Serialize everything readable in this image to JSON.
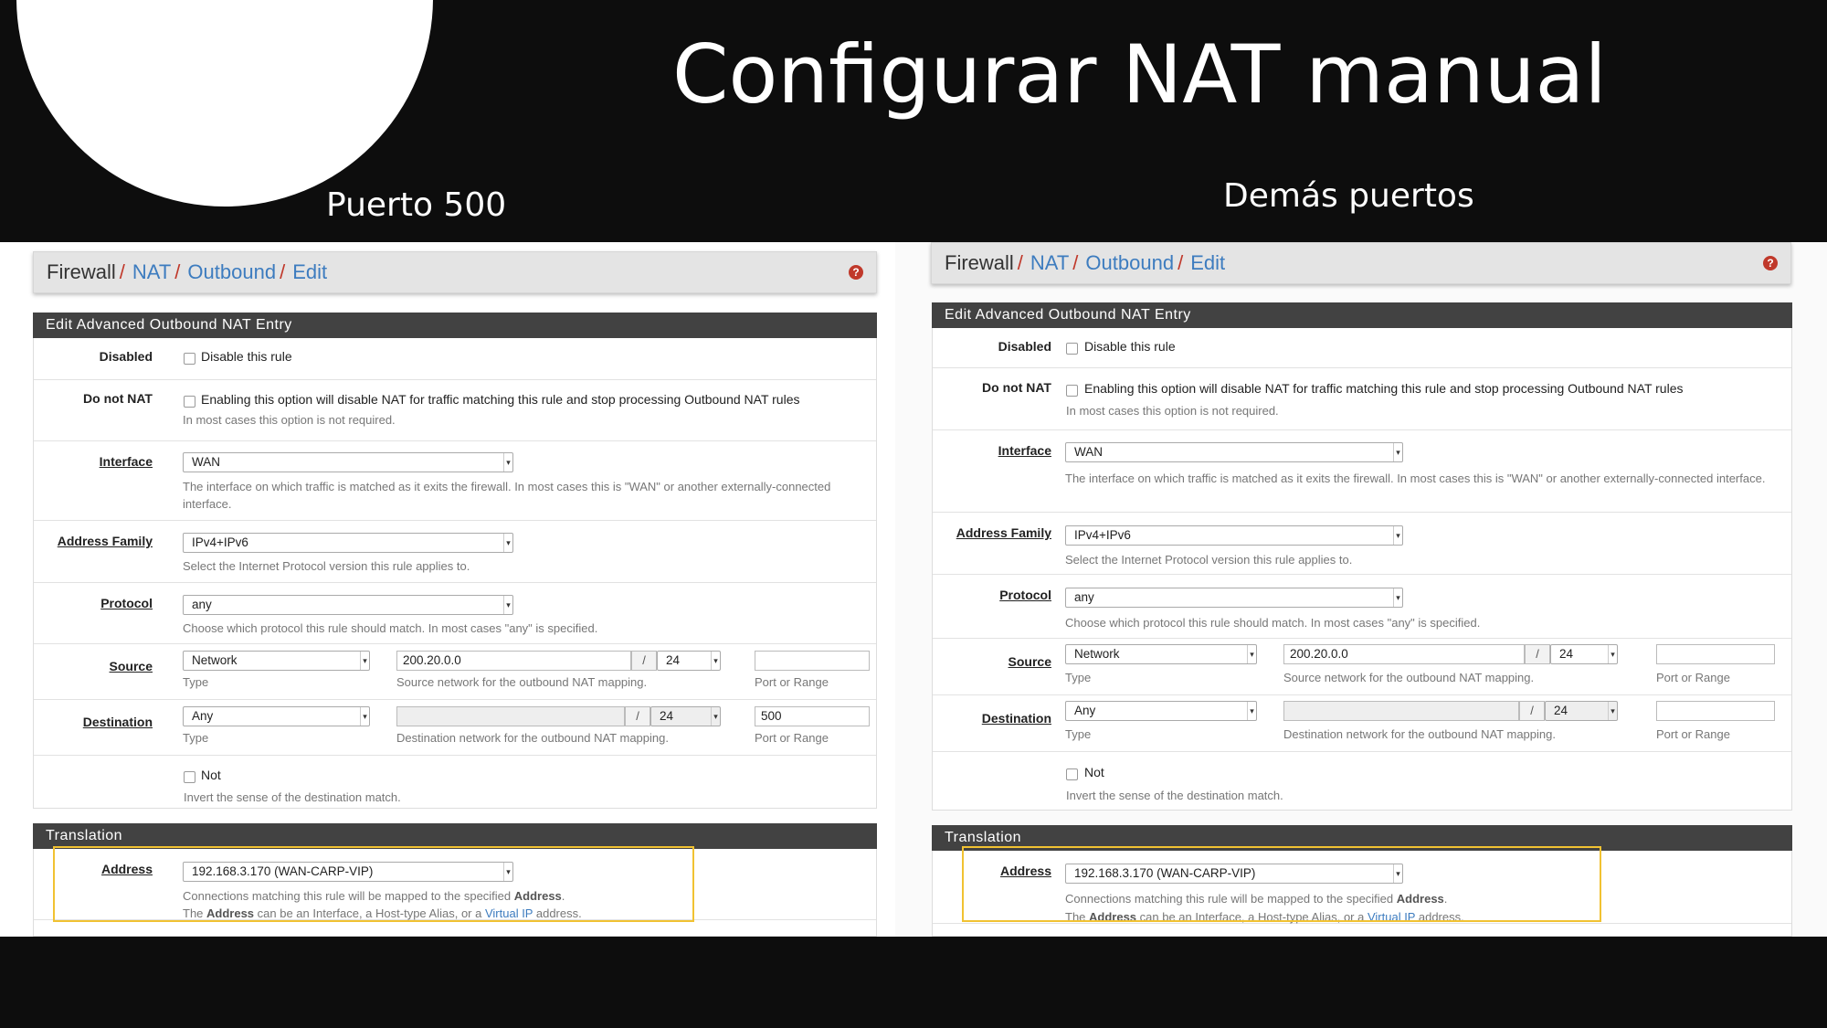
{
  "slide": {
    "title": "Configurar NAT manual",
    "subtitle_left": "Puerto 500",
    "subtitle_right": "Demás puertos"
  },
  "breadcrumb": {
    "firewall": "Firewall",
    "nat": "NAT",
    "outbound": "Outbound",
    "edit": "Edit",
    "sep": "/"
  },
  "help_icon": {
    "glyph": "?",
    "color": "#c0392b"
  },
  "sections": {
    "edit": "Edit Advanced Outbound NAT Entry",
    "translation": "Translation"
  },
  "labels": {
    "disabled": "Disabled",
    "do_not_nat": "Do not NAT",
    "interface": "Interface",
    "address_family": "Address Family",
    "protocol": "Protocol",
    "source": "Source",
    "destination": "Destination",
    "address": "Address"
  },
  "texts": {
    "disable_rule": "Disable this rule",
    "nonat_option": "Enabling this option will disable NAT for traffic matching this rule and stop processing Outbound NAT rules",
    "nonat_help": "In most cases this option is not required.",
    "interface_help": "The interface on which traffic is matched as it exits the firewall. In most cases this is \"WAN\" or another externally-connected interface.",
    "family_help": "Select the Internet Protocol version this rule applies to.",
    "protocol_help": "Choose which protocol this rule should match. In most cases \"any\" is specified.",
    "type": "Type",
    "source_net_help": "Source network for the outbound NAT mapping.",
    "dest_net_help": "Destination network for the outbound NAT mapping.",
    "port_or_range": "Port or Range",
    "not": "Not",
    "not_help": "Invert the sense of the destination match.",
    "addr_help1_a": "Connections matching this rule will be mapped to the specified ",
    "addr_help1_b": "Address",
    "addr_help1_c": ".",
    "addr_help2_a": "The ",
    "addr_help2_b": "Address",
    "addr_help2_c": " can be an Interface, a Host-type Alias, or a ",
    "addr_help2_link": "Virtual IP",
    "addr_help2_d": " address."
  },
  "left": {
    "interface": "WAN",
    "address_family": "IPv4+IPv6",
    "protocol": "any",
    "source_type": "Network",
    "source_network": "200.20.0.0",
    "source_mask": "24",
    "source_port": "",
    "dest_type": "Any",
    "dest_network": "",
    "dest_mask": "24",
    "dest_port": "500",
    "address": "192.168.3.170 (WAN-CARP-VIP)"
  },
  "right": {
    "interface": "WAN",
    "address_family": "IPv4+IPv6",
    "protocol": "any",
    "source_type": "Network",
    "source_network": "200.20.0.0",
    "source_mask": "24",
    "source_port": "",
    "dest_type": "Any",
    "dest_network": "",
    "dest_mask": "24",
    "dest_port": "",
    "address": "192.168.3.170 (WAN-CARP-VIP)"
  },
  "colors": {
    "link": "#3d7cbf",
    "separator": "#c0392b",
    "section_header": "#424242",
    "highlight": "#f1c232"
  }
}
